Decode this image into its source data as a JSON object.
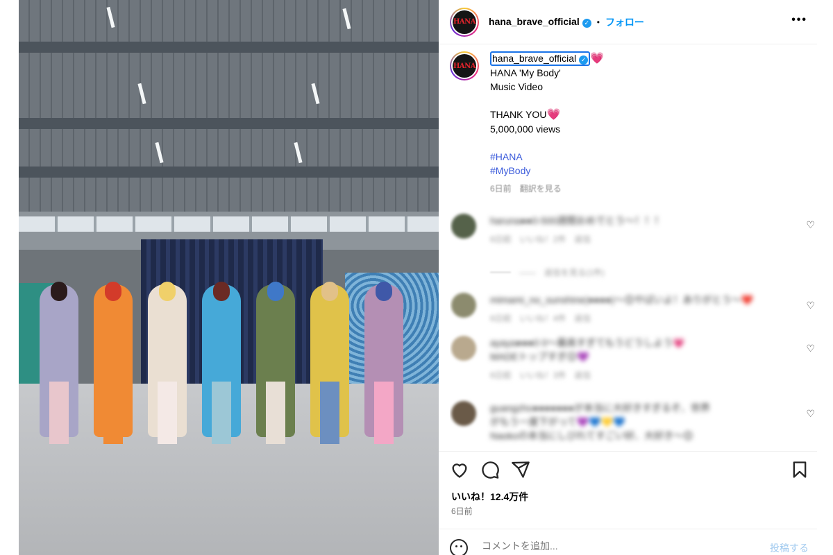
{
  "photo": {
    "members": [
      {
        "outfit": "#a8a5c7",
        "hair": "#2b1b1b",
        "legs": "#e8c6cc"
      },
      {
        "outfit": "#f08a34",
        "hair": "#d33b2a",
        "legs": "#f08a34"
      },
      {
        "outfit": "#eadfd2",
        "hair": "#f0d06a",
        "legs": "#f4e9e6"
      },
      {
        "outfit": "#46a9d8",
        "hair": "#6b2a24",
        "legs": "#9cc7d6"
      },
      {
        "outfit": "#6b7f4e",
        "hair": "#3f78c8",
        "legs": "#e8dfd6"
      },
      {
        "outfit": "#e0c24a",
        "hair": "#e2c188",
        "legs": "#6c8fc0"
      },
      {
        "outfit": "#b48fb4",
        "hair": "#3f58a8",
        "legs": "#f3a7c6"
      }
    ]
  },
  "header": {
    "avatar_text": "HANA",
    "username": "hana_brave_official",
    "verified_mark": "✓",
    "separator": "•",
    "follow_label": "フォロー",
    "more_label": "•••"
  },
  "caption": {
    "username": "hana_brave_official",
    "heart": "💗",
    "lines": [
      "HANA 'My Body'",
      "Music Video",
      "",
      "THANK YOU",
      "5,000,000 views",
      ""
    ],
    "heart_after_thanks": "💗",
    "hashtags": [
      "#HANA",
      "#MyBody"
    ],
    "time": "6日前",
    "translate": "翻訳を見る"
  },
  "comments": [
    {
      "text": "haruna●●0-500週間おめでとう〜！！！",
      "meta": "6日前　いいね！2件　返信",
      "avatar_color": "#55624a",
      "replies": "——　返信を見る(1件)"
    },
    {
      "text": "mimami_no_sunshine(●●●●)〜😊やばいよ！ありがとう〜❤️",
      "meta": "6日前　いいね！4件　返信",
      "avatar_color": "#8c8b6e",
      "replies": ""
    },
    {
      "text": "ayaya●●●0 0〜最高すぎてもうどうしよう💗",
      "text2": "MADEトップすぎ😊💜",
      "meta": "6日前　いいね！3件　返信",
      "avatar_color": "#b9a98e",
      "replies": ""
    },
    {
      "text": "guangzho●●●●●●●が本当に大好きすぎるぞ、世界",
      "text2": "がもう一度下がって💜💙💛💙",
      "text3": "Naokoの本当にしびれてすごい好、大好き〜😊",
      "meta": "",
      "avatar_color": "#6a5a48",
      "replies": ""
    }
  ],
  "likes": "いいね！12.4万件",
  "date": "6日前",
  "comment_box": {
    "placeholder": "コメントを追加...",
    "post_label": "投稿する"
  }
}
